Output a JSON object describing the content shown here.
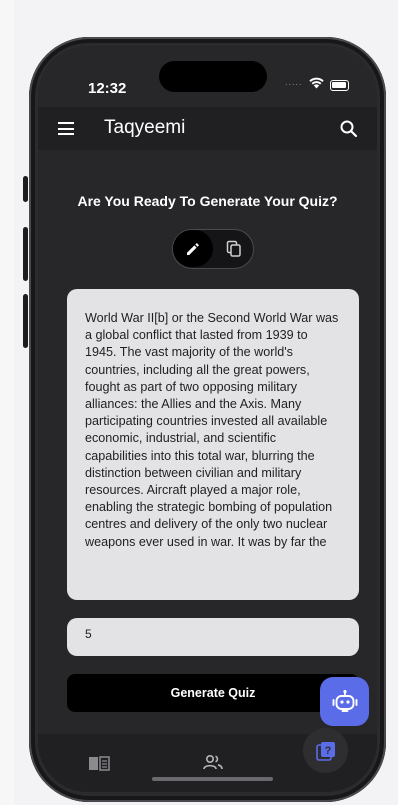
{
  "status_bar": {
    "time": "12:32",
    "signal_dots": "....."
  },
  "app_bar": {
    "title": "Taqyeemi"
  },
  "main": {
    "heading": "Are You Ready To Generate Your Quiz?",
    "mode_toggle": {
      "selected": "edit",
      "options": [
        "edit-icon",
        "copy-icon"
      ]
    },
    "source_text": "World War II[b] or the Second World War was a global conflict that lasted from 1939 to 1945. The vast majority of the world's countries, including all the great powers, fought as part of two opposing military alliances: the Allies and the Axis. Many participating countries invested all available economic, industrial, and scientific capabilities into this total war, blurring the distinction between civilian and military resources. Aircraft played a major role, enabling the strategic bombing of population centres and delivery of the only two nuclear weapons ever used in war. It was by far the",
    "question_count": "5",
    "generate_label": "Generate Quiz"
  },
  "fab": {
    "icon": "robot-icon",
    "color": "#5b6ce8"
  },
  "bottom_nav": {
    "items": [
      "book-icon",
      "people-icon",
      "quiz-icon"
    ]
  },
  "colors": {
    "background": "#27272a",
    "surface": "#202023",
    "field": "#e3e3e5",
    "accent": "#5b6ce8"
  }
}
